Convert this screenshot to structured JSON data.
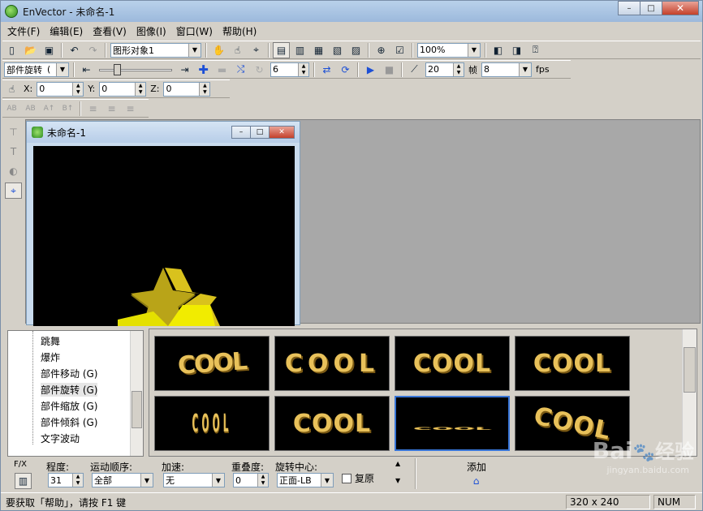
{
  "window": {
    "title": "EnVector - 未命名-1",
    "minimize": "–",
    "maximize": "□",
    "close": "✕"
  },
  "menu": [
    "文件(F)",
    "编辑(E)",
    "查看(V)",
    "图像(I)",
    "窗口(W)",
    "帮助(H)"
  ],
  "toolbar1": {
    "object_select": "图形对象1",
    "zoom": "100%"
  },
  "toolbar2": {
    "part_mode": "部件旋转",
    "part_mode_suffix": "(",
    "value1": "6",
    "value2": "20",
    "frame_label": "帧",
    "frame_value": "8",
    "fps_label": "fps"
  },
  "toolbar3": {
    "x_label": "X:",
    "x_value": "0",
    "y_label": "Y:",
    "y_value": "0",
    "z_label": "Z:",
    "z_value": "0"
  },
  "toolbar4": {
    "t1": "AB",
    "t2": "AB",
    "t3": "A↑",
    "t4": "B↑"
  },
  "child_window": {
    "title": "未命名-1"
  },
  "tree": {
    "items": [
      "跳舞",
      "爆炸",
      "部件移动 (G)",
      "部件旋转 (G)",
      "部件缩放 (G)",
      "部件倾斜 (G)",
      "文字波动"
    ]
  },
  "gallery": {
    "items": [
      "COOL",
      "COOL",
      "COOL",
      "COOL",
      "COOL",
      "COOL",
      "COOL",
      "COOL"
    ],
    "selected_index": 6
  },
  "params": {
    "fx_label": "F/X",
    "degree_label": "程度:",
    "degree_value": "31",
    "order_label": "运动顺序:",
    "order_value": "全部",
    "accel_label": "加速:",
    "accel_value": "无",
    "overlap_label": "重叠度:",
    "overlap_value": "0",
    "center_label": "旋转中心:",
    "center_value": "正面-LB",
    "restore_label": "复原",
    "add_label": "添加"
  },
  "status": {
    "help_text": "要获取「帮助」，请按 F1 键",
    "size": "320 x 240",
    "num": "NUM"
  },
  "watermark": {
    "brand": "Bai",
    "brand2": "经验",
    "url": "jingyan.baidu.com"
  },
  "colors": {
    "accent_gold": "#e8c15a",
    "selection_blue": "#3875d7"
  }
}
